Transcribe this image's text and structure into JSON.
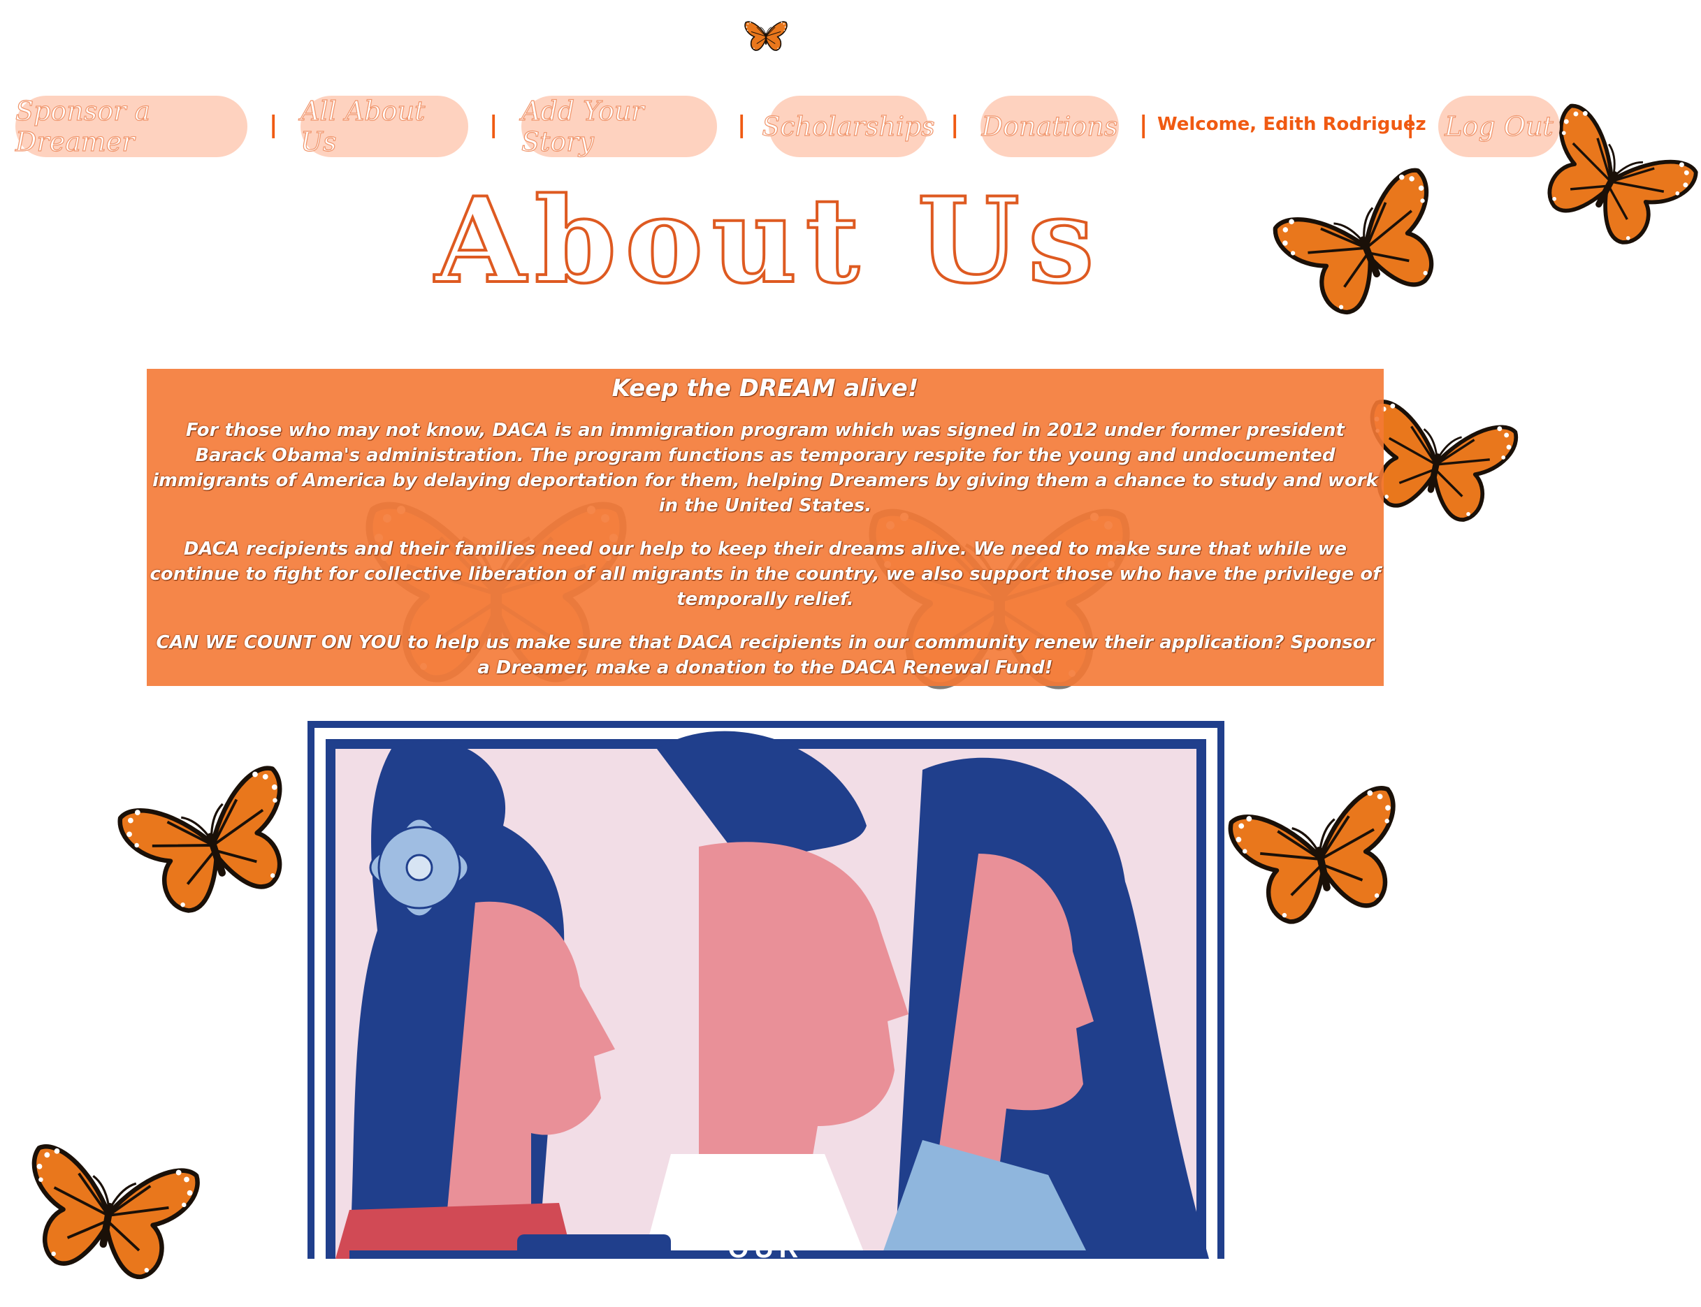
{
  "header": {
    "logo_icon": "butterfly-icon"
  },
  "nav": {
    "items": [
      {
        "label": "Sponsor a Dreamer"
      },
      {
        "label": "All About Us"
      },
      {
        "label": "Add Your Story"
      },
      {
        "label": "Scholarships"
      },
      {
        "label": "Donations"
      }
    ],
    "separator": "|",
    "welcome": "Welcome, Edith Rodriguez",
    "logout_label": "Log Out"
  },
  "page": {
    "title": "About Us"
  },
  "info": {
    "heading": "Keep the DREAM alive!",
    "paragraphs": [
      "For those who may not know, DACA is an immigration program which was signed in 2012 under former president Barack Obama's administration. The program functions as temporary respite for the young and undocumented immigrants of America by delaying deportation for them, helping Dreamers by giving them a chance to study and work in the United States.",
      "DACA recipients and their families need our help to keep their dreams alive. We need to make sure that while we continue to fight for collective liberation of all migrants in the country, we also support those who have the privilege of temporally relief.",
      "CAN WE COUNT ON YOU to help us make sure that DACA recipients in our community renew their application? Sponsor a Dreamer, make a donation to the DACA Renewal Fund!"
    ]
  },
  "poster": {
    "banner_text": "OUR"
  },
  "colors": {
    "accent": "#f05a12",
    "nav_pill": "#fed2bf",
    "panel": "#f47935",
    "title_stroke": "#de5a21",
    "poster_navy": "#203f8c",
    "poster_pink": "#f2dde6"
  }
}
